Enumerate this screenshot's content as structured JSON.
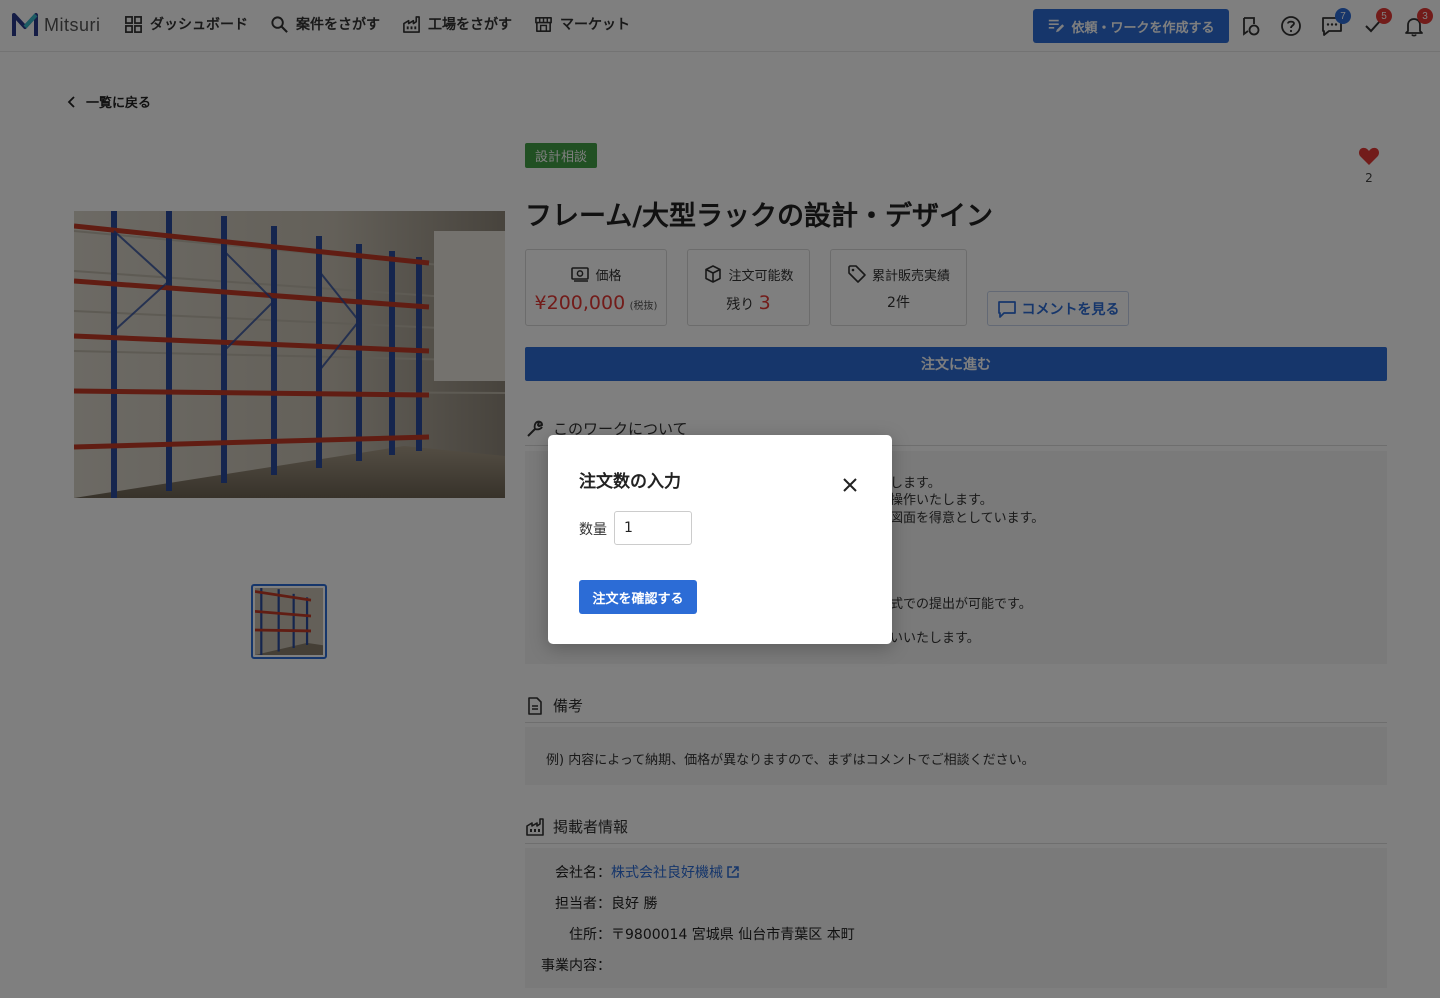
{
  "header": {
    "logo_text": "Mitsuri",
    "nav": [
      {
        "label": "ダッシュボード",
        "icon": "dashboard-icon"
      },
      {
        "label": "案件をさがす",
        "icon": "search-icon"
      },
      {
        "label": "工場をさがす",
        "icon": "factory-icon"
      },
      {
        "label": "マーケット",
        "icon": "store-icon"
      }
    ],
    "create_button": "依頼・ワークを作成する",
    "badges": {
      "messages": "7",
      "tasks": "5",
      "notifications": "3"
    }
  },
  "back_link": "一覧に戻る",
  "product": {
    "category_tag": "設計相談",
    "title": "フレーム/大型ラックの設計・デザイン",
    "favorites": "2",
    "price": {
      "label": "価格",
      "value": "¥200,000",
      "tax_note": "(税抜)"
    },
    "stock": {
      "label": "注文可能数",
      "prefix": "残り",
      "count": "3"
    },
    "sales": {
      "label": "累計販売実績",
      "value": "2件"
    },
    "comment_button": "コメントを見る",
    "order_button": "注文に進む"
  },
  "about": {
    "heading": "このワークについて",
    "lines": [
      "します。",
      "操作いたします。",
      "図面を得意としています。",
      "式での提出が可能です。",
      "いいたします。"
    ]
  },
  "notes": {
    "heading": "備考",
    "text": "例) 内容によって納期、価格が異なりますので、まずはコメントでご相談ください。"
  },
  "poster": {
    "heading": "掲載者情報",
    "company_label": "会社名：",
    "company": "株式会社良好機械",
    "person_label": "担当者：",
    "person": "良好 勝",
    "address_label": "住所：",
    "address": "〒9800014 宮城県 仙台市青葉区 本町",
    "business_label": "事業内容："
  },
  "modal": {
    "title": "注文数の入力",
    "quantity_label": "数量",
    "quantity_value": "1",
    "confirm_button": "注文を確認する"
  },
  "colors": {
    "primary": "#2c6cd6",
    "tag_green": "#43a047",
    "price_red": "#e53935",
    "heart": "#e53935"
  }
}
